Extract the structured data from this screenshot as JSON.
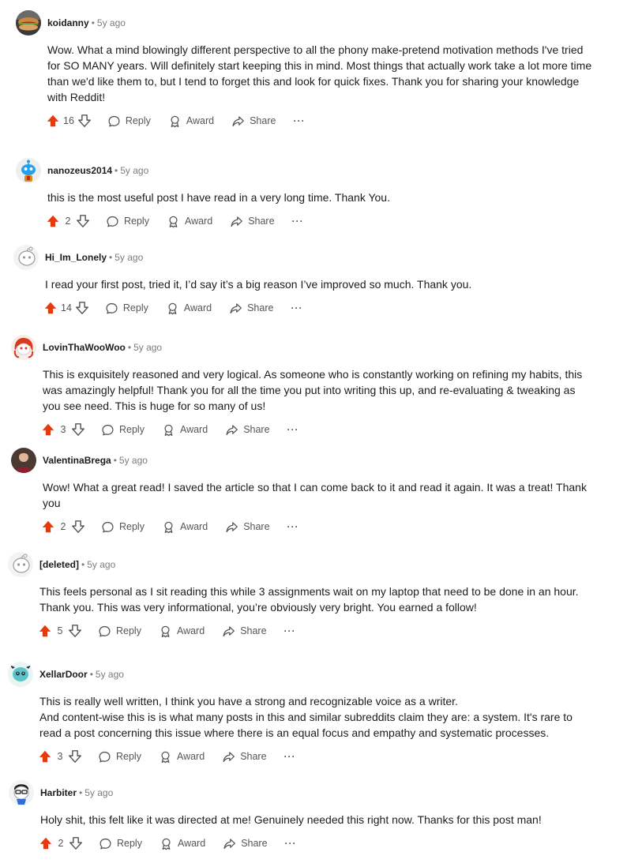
{
  "labels": {
    "reply": "Reply",
    "award": "Award",
    "share": "Share",
    "more": "···",
    "separator": "•"
  },
  "colors": {
    "upvote": "#e8390d",
    "icon": "#555555",
    "meta": "#7c7c7c"
  },
  "comments": [
    {
      "username": "koidanny",
      "age": "5y ago",
      "avatar": "food-avatar",
      "text": "Wow. What a mind blowingly different perspective to all the phony make-pretend motivation methods I've tried for SO MANY years. Will definitely start keeping this in mind. Most things that actually work take a lot more time than we'd like them to, but I tend to forget this and look for quick fixes. Thank you for sharing your knowledge with Reddit!",
      "score": "16"
    },
    {
      "username": "nanozeus2014",
      "age": "5y ago",
      "avatar": "snoo-blue-avatar",
      "text": "this is the most useful post I have read in a very long time. Thank You.",
      "score": "2"
    },
    {
      "username": "Hi_Im_Lonely",
      "age": "5y ago",
      "avatar": "snoo-outline-avatar",
      "text": "I read your first post, tried it, I’d say it’s a big reason I’ve improved so much. Thank you.",
      "score": "14"
    },
    {
      "username": "LovinThaWooWoo",
      "age": "5y ago",
      "avatar": "snoo-redhair-avatar",
      "text": "This is exquisitely reasoned and very logical. As someone who is constantly working on refining my habits, this was amazingly helpful! Thank you for all the time you put into writing this up, and re-evaluating & tweaking as you see need. This is huge for so many of us!",
      "score": "3"
    },
    {
      "username": "ValentinaBrega",
      "age": "5y ago",
      "avatar": "photo-avatar",
      "text": "Wow! What a great read! I saved the article so that I can come back to it and read it again. It was a treat! Thank you",
      "score": "2"
    },
    {
      "username": "[deleted]",
      "age": "5y ago",
      "avatar": "snoo-outline-avatar",
      "text": "This feels personal as I sit reading this while 3 assignments wait on my laptop that need to be done in an hour. Thank you. This was very informational, you’re obviously very bright. You earned a follow!",
      "score": "5"
    },
    {
      "username": "XellarDoor",
      "age": "5y ago",
      "avatar": "snoo-cyan-avatar",
      "text": "This is really well written, I think you have a strong and recognizable voice as a writer.",
      "text2": "And content-wise this is is what many posts in this and similar subreddits claim they are: a system. It's rare to read a post concerning this issue where there is an equal focus and empathy and systematic processes.",
      "score": "3"
    },
    {
      "username": "Harbiter",
      "age": "5y ago",
      "avatar": "snoo-glasses-avatar",
      "text": "Holy shit, this felt like it was directed at me! Genuinely needed this right now. Thanks for this post man!",
      "score": "2"
    }
  ]
}
